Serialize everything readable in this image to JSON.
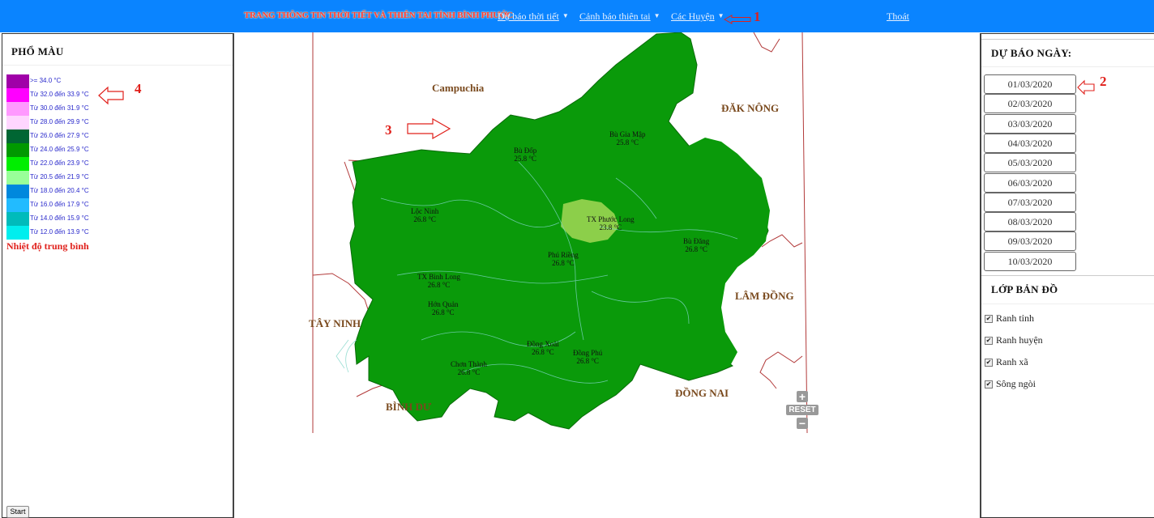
{
  "header": {
    "title": "TRANG THÔNG TIN THỜI TIẾT VÀ THIÊN TAI TỈNH BÌNH PHƯỚC",
    "nav": [
      {
        "label": "Dự báo thời tiết"
      },
      {
        "label": "Cảnh báo thiên tai"
      },
      {
        "label": "Các Huyện"
      }
    ],
    "logout": "Thoát"
  },
  "annotations": [
    "1",
    "2",
    "3",
    "4"
  ],
  "legend": {
    "title": "PHỔ MÀU",
    "items": [
      {
        "label": ">= 34.0 °C",
        "color": "#a000a8"
      },
      {
        "label": "Từ 32.0 đến 33.9 °C",
        "color": "#ff00ff"
      },
      {
        "label": "Từ 30.0 đến 31.9 °C",
        "color": "#ff99ff"
      },
      {
        "label": "Từ 28.0 đến 29.9 °C",
        "color": "#ffd6ff"
      },
      {
        "label": "Từ 26.0 đến 27.9 °C",
        "color": "#006633"
      },
      {
        "label": "Từ 24.0 đến 25.9 °C",
        "color": "#009900"
      },
      {
        "label": "Từ 22.0 đến 23.9 °C",
        "color": "#00ee00"
      },
      {
        "label": "Từ 20.5 đến 21.9 °C",
        "color": "#99ff99"
      },
      {
        "label": "Từ 18.0 đến 20.4 °C",
        "color": "#0088dd"
      },
      {
        "label": "Từ 16.0 đến 17.9 °C",
        "color": "#22bbff"
      },
      {
        "label": "Từ 14.0 đến 15.9 °C",
        "color": "#00bbbb"
      },
      {
        "label": "Từ 12.0 đến 13.9 °C",
        "color": "#00eeee"
      }
    ],
    "footer": "Nhiệt độ trung bình"
  },
  "forecast": {
    "title": "DỰ BÁO NGÀY:",
    "dates": [
      "01/03/2020",
      "02/03/2020",
      "03/03/2020",
      "04/03/2020",
      "05/03/2020",
      "06/03/2020",
      "07/03/2020",
      "08/03/2020",
      "09/03/2020",
      "10/03/2020"
    ]
  },
  "layers": {
    "title": "LỚP BẢN ĐỒ",
    "items": [
      {
        "label": "Ranh tỉnh",
        "checked": true
      },
      {
        "label": "Ranh huyện",
        "checked": true
      },
      {
        "label": "Ranh xã",
        "checked": true
      },
      {
        "label": "Sông ngòi",
        "checked": true
      }
    ]
  },
  "map": {
    "regions": [
      "Campuchia",
      "ĐĂK NÔNG",
      "LÂM ĐỒNG",
      "TÂY NINH",
      "ĐỒNG NAI",
      "BÌNH DƯ"
    ],
    "districts": [
      {
        "name": "Bù Gia Mập",
        "temp": "25.8 °C"
      },
      {
        "name": "Bù Đốp",
        "temp": "25.8 °C"
      },
      {
        "name": "Lộc Ninh",
        "temp": "26.8 °C"
      },
      {
        "name": "TX Phước Long",
        "temp": "23.8 °C"
      },
      {
        "name": "Bù Đăng",
        "temp": "26.8 °C"
      },
      {
        "name": "Phú Riềng",
        "temp": "26.8 °C"
      },
      {
        "name": "TX Bình Long",
        "temp": "26.8 °C"
      },
      {
        "name": "Hớn Quản",
        "temp": "26.8 °C"
      },
      {
        "name": "Đồng Xoài",
        "temp": "26.8 °C"
      },
      {
        "name": "Đồng Phú",
        "temp": "26.8 °C"
      },
      {
        "name": "Chơn Thành",
        "temp": "26.8 °C"
      }
    ],
    "zoom_in": "+",
    "reset": "RESET",
    "zoom_out": "−"
  },
  "start_button": "Start"
}
